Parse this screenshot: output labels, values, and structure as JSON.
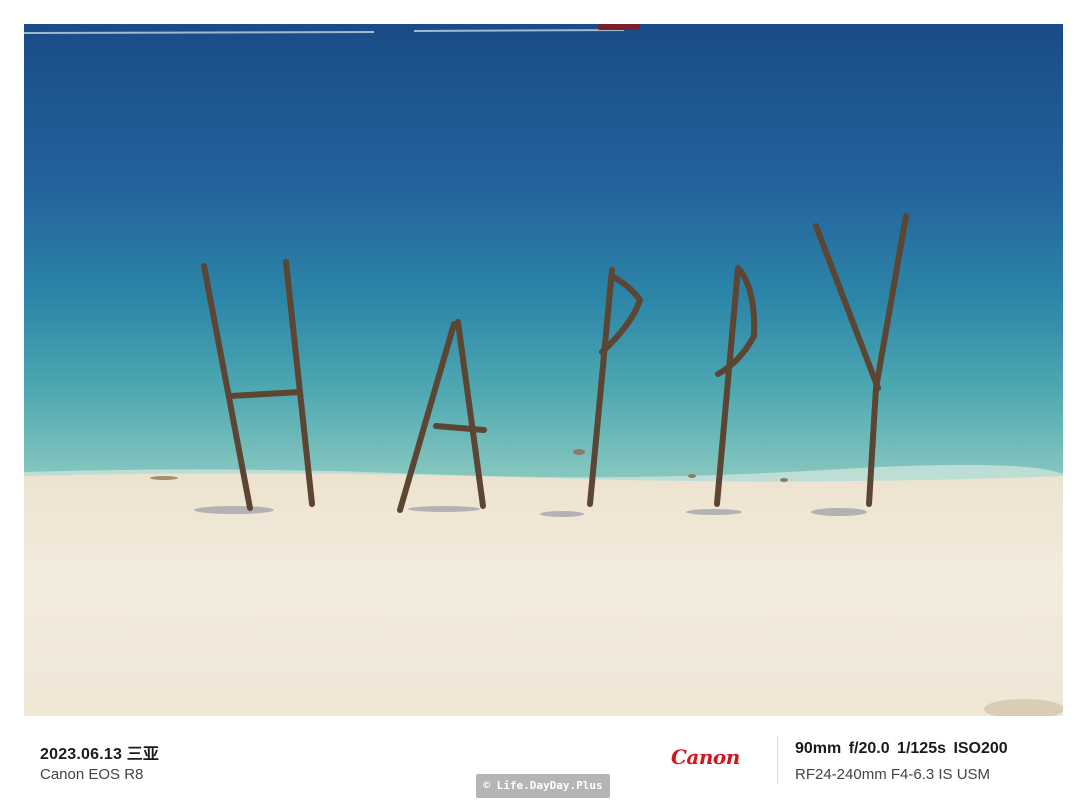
{
  "footer": {
    "date_location": "2023.06.13 三亚",
    "camera_model": "Canon EOS R8",
    "brand_logo": "Canon",
    "exposure": "90mm  f/20.0  1/125s  ISO200",
    "lens_model": "RF24-240mm F4-6.3 IS USM",
    "watermark": "© Life.DayDay.Plus"
  },
  "photo": {
    "colors": {
      "sea_deep": "#1c4f8c",
      "sea_mid": "#2d77a6",
      "sea_shallow": "#5fb7b9",
      "sand": "#f1e9d9",
      "driftwood": "#5c4532"
    }
  }
}
